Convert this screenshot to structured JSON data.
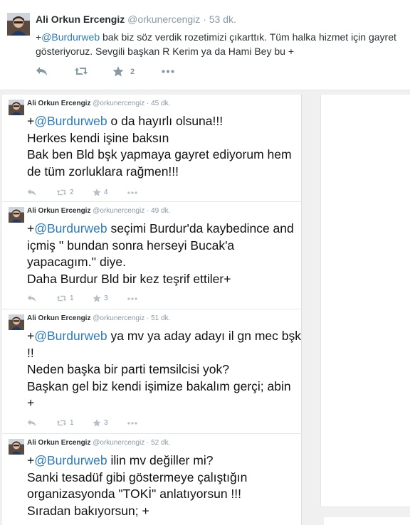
{
  "top_tweet": {
    "name": "Ali Orkun Ercengiz",
    "handle": "@orkunercengiz",
    "time": "53 dk.",
    "mention": "@Burdurweb",
    "prefix": "+",
    "text": " bak biz söz verdik rozetimizi çıkarttık. Tüm halka hizmet için gayret gösteriyoruz. Sevgili başkan R Kerim ya da Hami Bey bu +",
    "retweets": "",
    "favorites": "2"
  },
  "tweets": [
    {
      "name": "Ali Orkun Ercengiz",
      "handle": "@orkunercengiz",
      "time": "45 dk.",
      "prefix": "+",
      "mention": "@Burdurweb",
      "text": " o da hayırlı olsuna!!!\nHerkes kendi işine baksın\nBak ben Bld bşk yapmaya gayret ediyorum hem de tüm zorluklara rağmen!!!",
      "retweets": "2",
      "favorites": "4"
    },
    {
      "name": "Ali Orkun Ercengiz",
      "handle": "@orkunercengiz",
      "time": "49 dk.",
      "prefix": "+",
      "mention": "@Burdurweb",
      "text": "  seçimi Burdur'da kaybedince and içmiş '' bundan sonra herseyi Bucak'a yapacagım.'' diye.\nDaha Burdur Bld bir kez teşrif ettiler+",
      "retweets": "1",
      "favorites": "3"
    },
    {
      "name": "Ali Orkun Ercengiz",
      "handle": "@orkunercengiz",
      "time": "51 dk.",
      "prefix": "+",
      "mention": "@Burdurweb",
      "text": "  ya mv ya aday adayı il gn mec bşk !!\nNeden başka bir parti temsilcisi yok?\nBaşkan gel biz kendi işimize bakalım gerçi; abin +",
      "retweets": "1",
      "favorites": "3"
    },
    {
      "name": "Ali Orkun Ercengiz",
      "handle": "@orkunercengiz",
      "time": "52 dk.",
      "prefix": "+",
      "mention": "@Burdurweb",
      "text": "  ilin mv değiller mi?\nSanki tesadüf gibi göstermeye çalıştığın organizasyonda \"TOKİ\" anlatıyorsun !!!\nSıradan bakıyorsun; +",
      "retweets": "",
      "favorites": ""
    }
  ]
}
